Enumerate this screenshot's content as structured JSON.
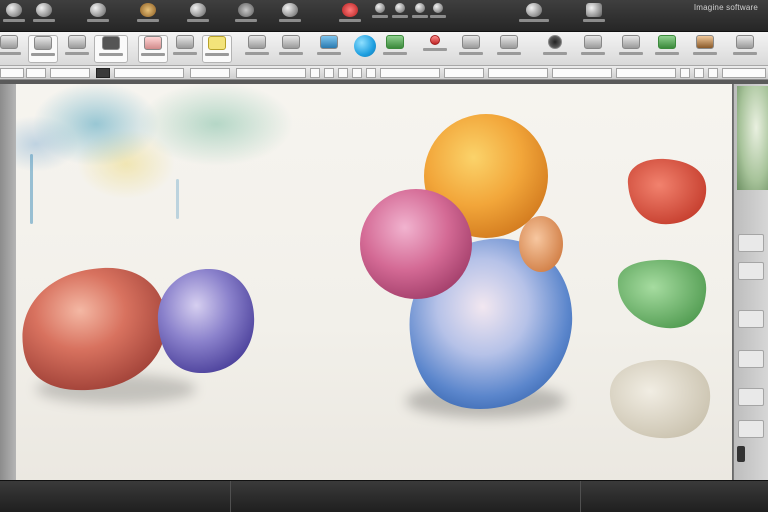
{
  "topbar": {
    "brand_text": "Imagine software",
    "tool_count": 18
  },
  "colors": {
    "chrome_dark": "#262626",
    "ribbon_light": "#f4f4f4",
    "canvas_paper": "#f4f2ec",
    "accent_blue": "#1e9fe0",
    "stone_red": "#c9504a",
    "stone_purple": "#6e64b4",
    "stone_yellow": "#f3b23a",
    "stone_pink": "#d46a95",
    "stone_blue": "#4d7fc8",
    "swatch_red": "#d9442f",
    "swatch_green": "#5aa25a",
    "swatch_beige": "#d8d2c2"
  },
  "icons": {
    "format_bold": "bold-icon",
    "brush": "brush-icon",
    "color_picker": "color-picker-icon",
    "layers": "layers-icon"
  }
}
